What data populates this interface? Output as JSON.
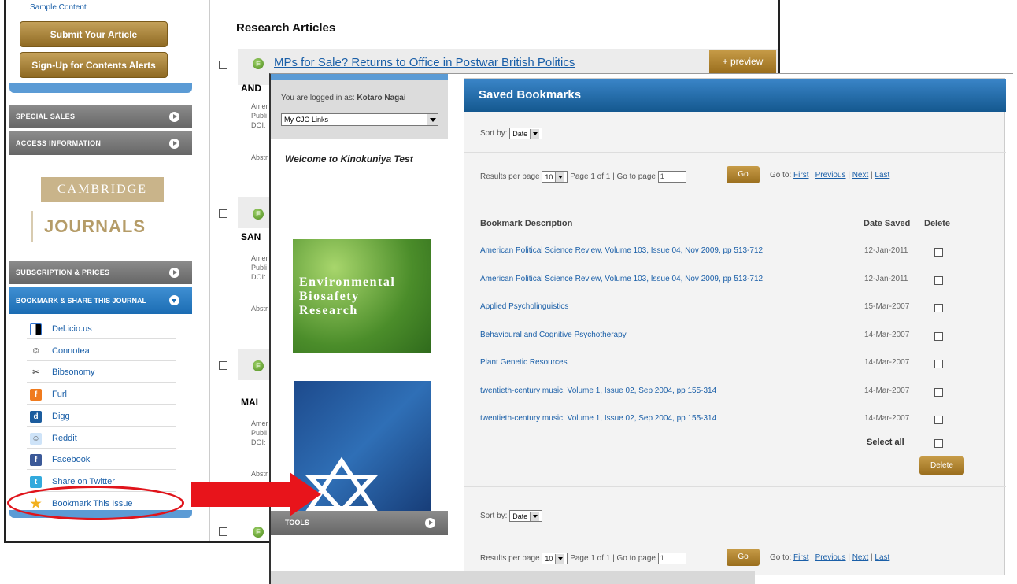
{
  "back_window": {
    "sidebar": {
      "sample_content": "Sample Content",
      "submit_btn": "Submit Your Article",
      "signup_btn": "Sign-Up for Contents Alerts",
      "special_sales": "SPECIAL SALES",
      "access_info": "ACCESS INFORMATION",
      "logo_top": "CAMBRIDGE",
      "logo_bottom": "JOURNALS",
      "subscription": "SUBSCRIPTION & PRICES",
      "bookmark_share": "BOOKMARK & SHARE THIS JOURNAL",
      "social": [
        {
          "label": "Del.icio.us",
          "icon": "delicious-icon"
        },
        {
          "label": "Connotea",
          "icon": "connotea-icon"
        },
        {
          "label": "Bibsonomy",
          "icon": "bibsonomy-icon"
        },
        {
          "label": "Furl",
          "icon": "furl-icon"
        },
        {
          "label": "Digg",
          "icon": "digg-icon"
        },
        {
          "label": "Reddit",
          "icon": "reddit-icon"
        },
        {
          "label": "Facebook",
          "icon": "facebook-icon"
        },
        {
          "label": "Share on Twitter",
          "icon": "twitter-icon"
        },
        {
          "label": "Bookmark This Issue",
          "icon": "star-icon"
        }
      ]
    },
    "main": {
      "heading": "Research Articles",
      "article1_title": "MPs for Sale? Returns to Office in Postwar British Politics",
      "preview_btn": "+ preview",
      "authors": [
        "AND",
        "SAN",
        "MAI"
      ],
      "meta_lines": [
        "Amer",
        "Publi",
        "DOI:"
      ],
      "abstract": "Abstr"
    }
  },
  "front_window": {
    "logged_in_prefix": "You are logged in as:",
    "user": "Kotaro Nagai",
    "links_select": "My CJO Links",
    "welcome": "Welcome to Kinokuniya Test",
    "cover1_lines": [
      "Environmental",
      "Biosafety",
      "Research"
    ],
    "tools": "TOOLS",
    "panel_title": "Saved Bookmarks",
    "sort_by": "Sort by:",
    "sort_value": "Date",
    "results_per_page": "Results per page",
    "rpp_value": "10",
    "page_info": "Page 1 of 1 | Go to page",
    "page_input": "1",
    "go_btn": "Go",
    "goto_label": "Go to:",
    "nav": [
      "First",
      "Previous",
      "Next",
      "Last"
    ],
    "col_desc": "Bookmark Description",
    "col_date": "Date Saved",
    "col_delete": "Delete",
    "rows": [
      {
        "desc": "American Political Science Review, Volume 103, Issue 04, Nov 2009, pp 513-712",
        "date": "12-Jan-2011"
      },
      {
        "desc": "American Political Science Review, Volume 103, Issue 04, Nov 2009, pp 513-712",
        "date": "12-Jan-2011"
      },
      {
        "desc": "Applied Psycholinguistics",
        "date": "15-Mar-2007"
      },
      {
        "desc": "Behavioural and Cognitive Psychotherapy",
        "date": "14-Mar-2007"
      },
      {
        "desc": "Plant Genetic Resources",
        "date": "14-Mar-2007"
      },
      {
        "desc": "twentieth-century music, Volume 1, Issue 02, Sep 2004, pp 155-314",
        "date": "14-Mar-2007"
      },
      {
        "desc": "twentieth-century music, Volume 1, Issue 02, Sep 2004, pp 155-314",
        "date": "14-Mar-2007"
      }
    ],
    "select_all": "Select all",
    "delete_btn": "Delete"
  },
  "colors": {
    "annotation_red": "#e8141b",
    "header_blue": "#1b6cb3",
    "gold": "#a57a2a"
  }
}
